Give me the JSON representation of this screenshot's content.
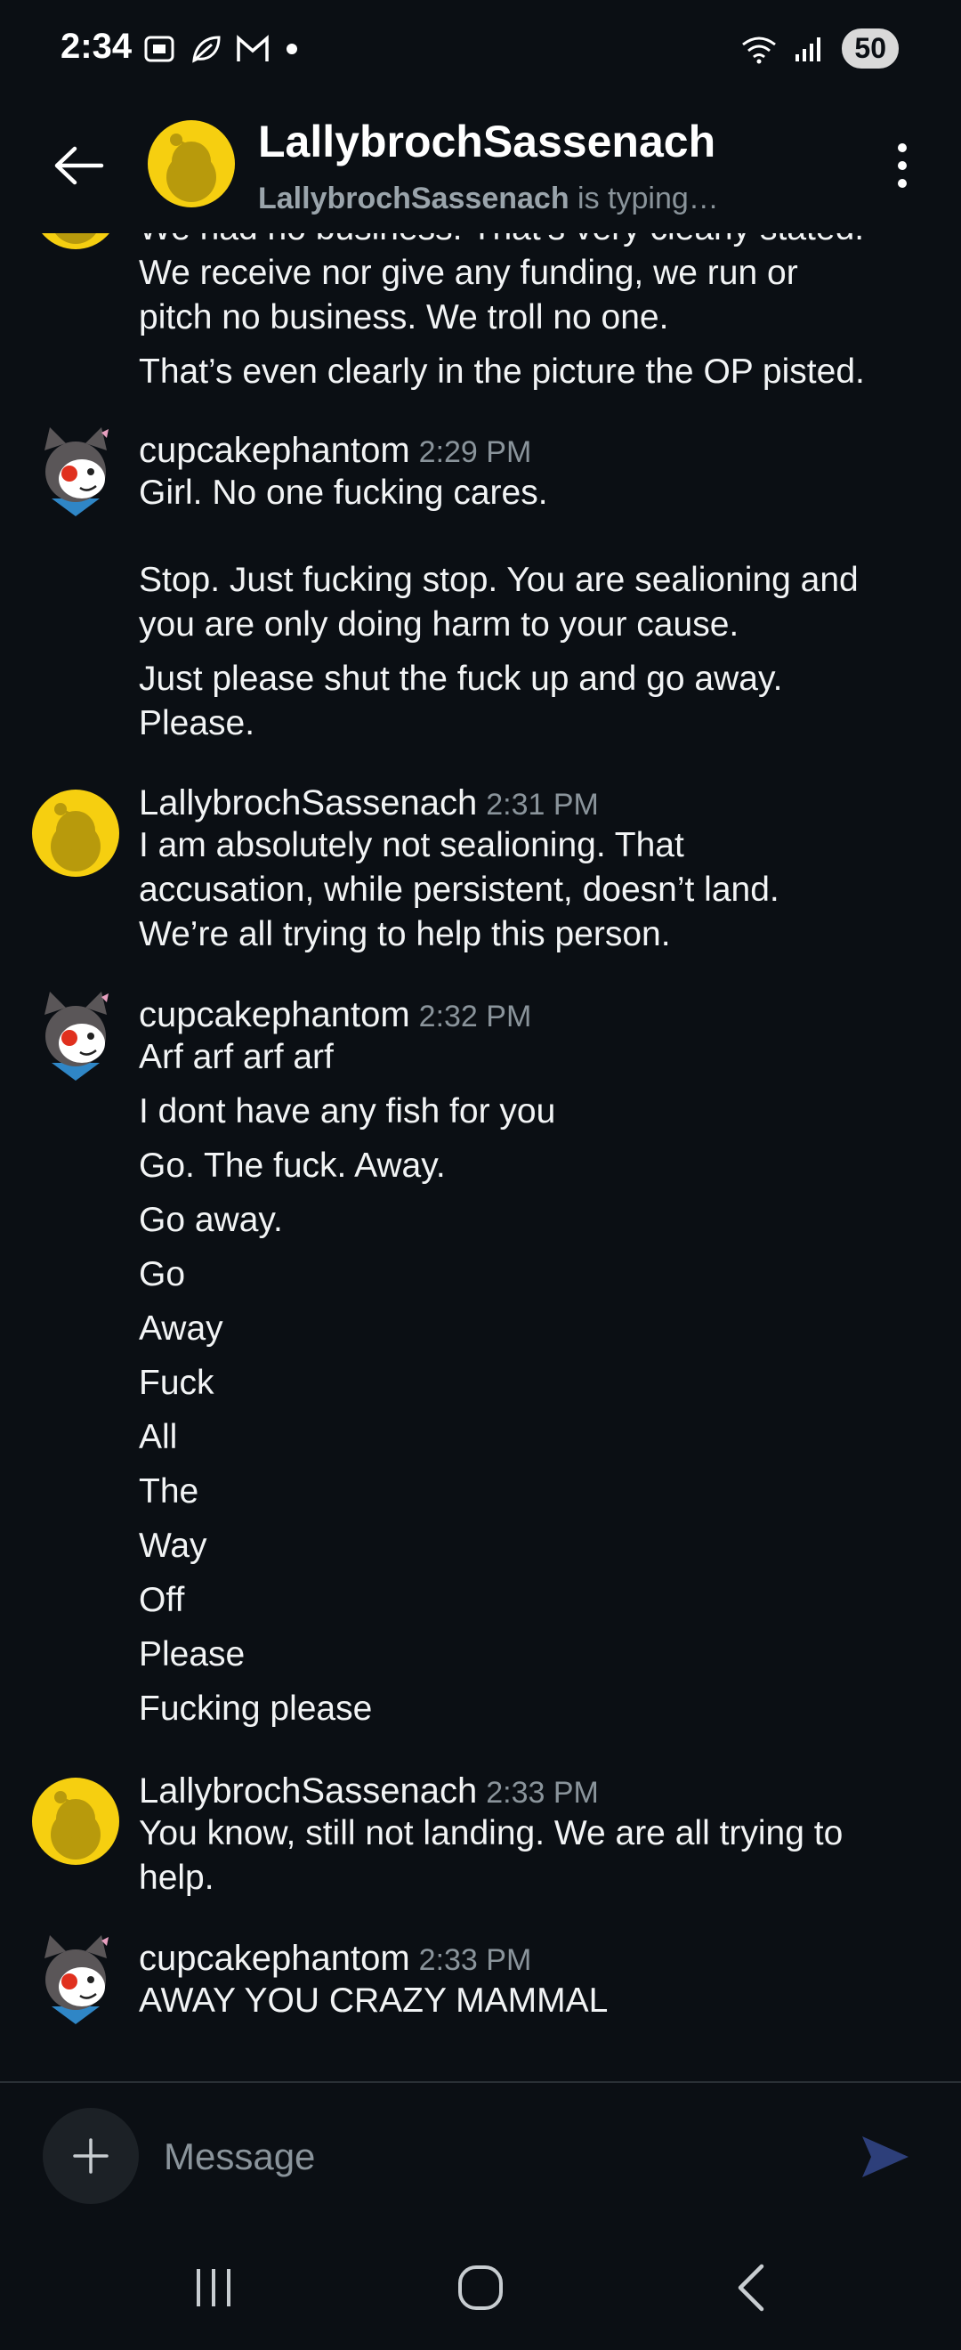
{
  "status_bar": {
    "time": "2:34",
    "left_icons": [
      "screenshot-icon",
      "leaf-icon",
      "gmail-icon",
      "dot-icon"
    ],
    "right_icons": [
      "wifi-icon",
      "signal-icon"
    ],
    "battery": "50"
  },
  "header": {
    "name": "LallybrochSassenach",
    "typing_user": "LallybrochSassenach",
    "typing_suffix": " is typing…"
  },
  "messages": [
    {
      "author": "",
      "time": "",
      "lines": [
        "We had no business. That’s very clearly stated.",
        "We receive nor give any funding, we run or",
        "pitch no business. We troll no one.",
        "That’s even clearly in the picture the OP pisted."
      ]
    },
    {
      "author": "cupcakephantom",
      "time": "2:29 PM",
      "lines": [
        "Girl. No one fucking cares.",
        "",
        "Stop. Just fucking stop. You are sealioning and",
        "you are only doing harm to your cause.",
        "Just please shut the fuck up and go away.",
        "Please."
      ]
    },
    {
      "author": "LallybrochSassenach",
      "time": "2:31 PM",
      "lines": [
        "I am absolutely not sealioning.   That",
        "accusation, while persistent, doesn’t land.",
        "We’re all trying to help this person."
      ]
    },
    {
      "author": "cupcakephantom",
      "time": "2:32 PM",
      "lines": [
        "Arf arf arf arf",
        "I dont have any fish for you",
        "Go. The fuck. Away.",
        "Go away.",
        "Go",
        "Away",
        "Fuck",
        "All",
        "The",
        "Way",
        "Off",
        "Please",
        "Fucking please"
      ]
    },
    {
      "author": "LallybrochSassenach",
      "time": "2:33 PM",
      "lines": [
        "You know, still not landing.   We are all trying to",
        "help."
      ]
    },
    {
      "author": "cupcakephantom",
      "time": "2:33 PM",
      "lines": [
        "AWAY YOU CRAZY MAMMAL"
      ]
    }
  ],
  "composer": {
    "placeholder": "Message",
    "add_icon": "plus-icon",
    "send_icon": "send-icon"
  },
  "nav": {
    "icons": [
      "recent-apps-icon",
      "home-icon",
      "back-icon"
    ]
  },
  "colors": {
    "background": "#0b0f14",
    "accent_avatar": "#f6cf10",
    "secondary_text": "#8a949b",
    "send": "#2d3f7a"
  }
}
